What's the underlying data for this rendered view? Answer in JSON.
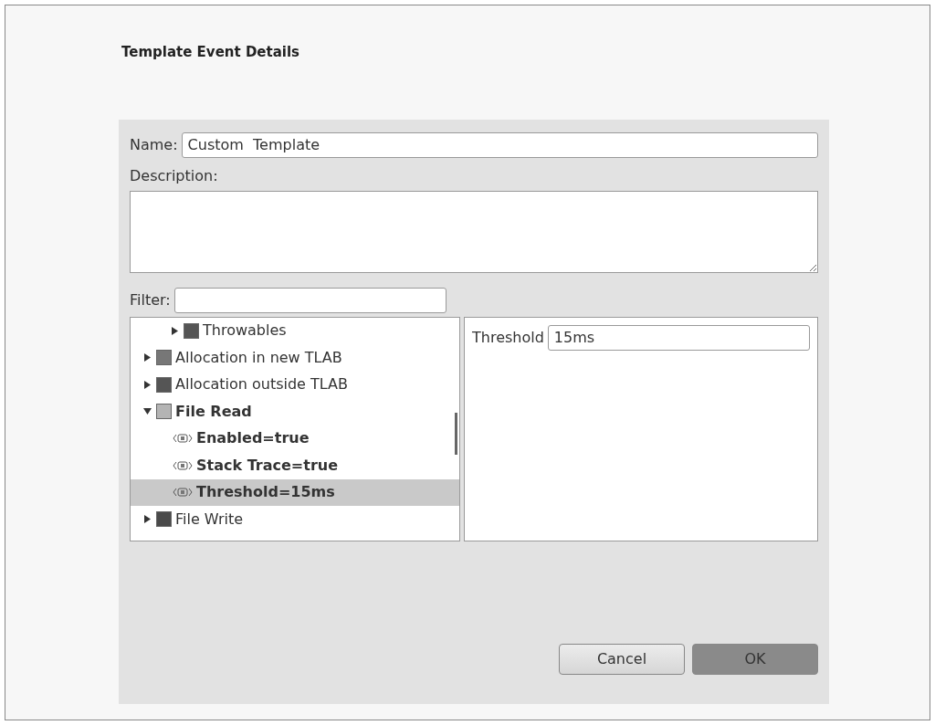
{
  "figure_title": "Template Event Details",
  "name": {
    "label": "Name:",
    "value": "Custom  Template"
  },
  "description": {
    "label": "Description:"
  },
  "filter": {
    "label": "Filter:"
  },
  "tree": {
    "scrolled_children": [
      {
        "label": "Throwables",
        "color": "#555555",
        "expanded": false
      }
    ],
    "items": [
      {
        "label": "Allocation in new TLAB",
        "color": "#777777",
        "expanded": false
      },
      {
        "label": "Allocation outside TLAB",
        "color": "#555555",
        "expanded": false
      },
      {
        "label": "File Read",
        "color": "#b4b4b4",
        "expanded": true,
        "children": [
          {
            "label": "Enabled=true",
            "selected": false
          },
          {
            "label": "Stack Trace=true",
            "selected": false
          },
          {
            "label": "Threshold=15ms",
            "selected": true
          }
        ]
      },
      {
        "label": "File Write",
        "color": "#4a4a4a",
        "expanded": false
      }
    ]
  },
  "setting": {
    "label": "Threshold",
    "value": "15ms"
  },
  "buttons": [
    {
      "label": "Cancel",
      "kind": "secondary"
    },
    {
      "label": "OK",
      "kind": "default"
    }
  ]
}
